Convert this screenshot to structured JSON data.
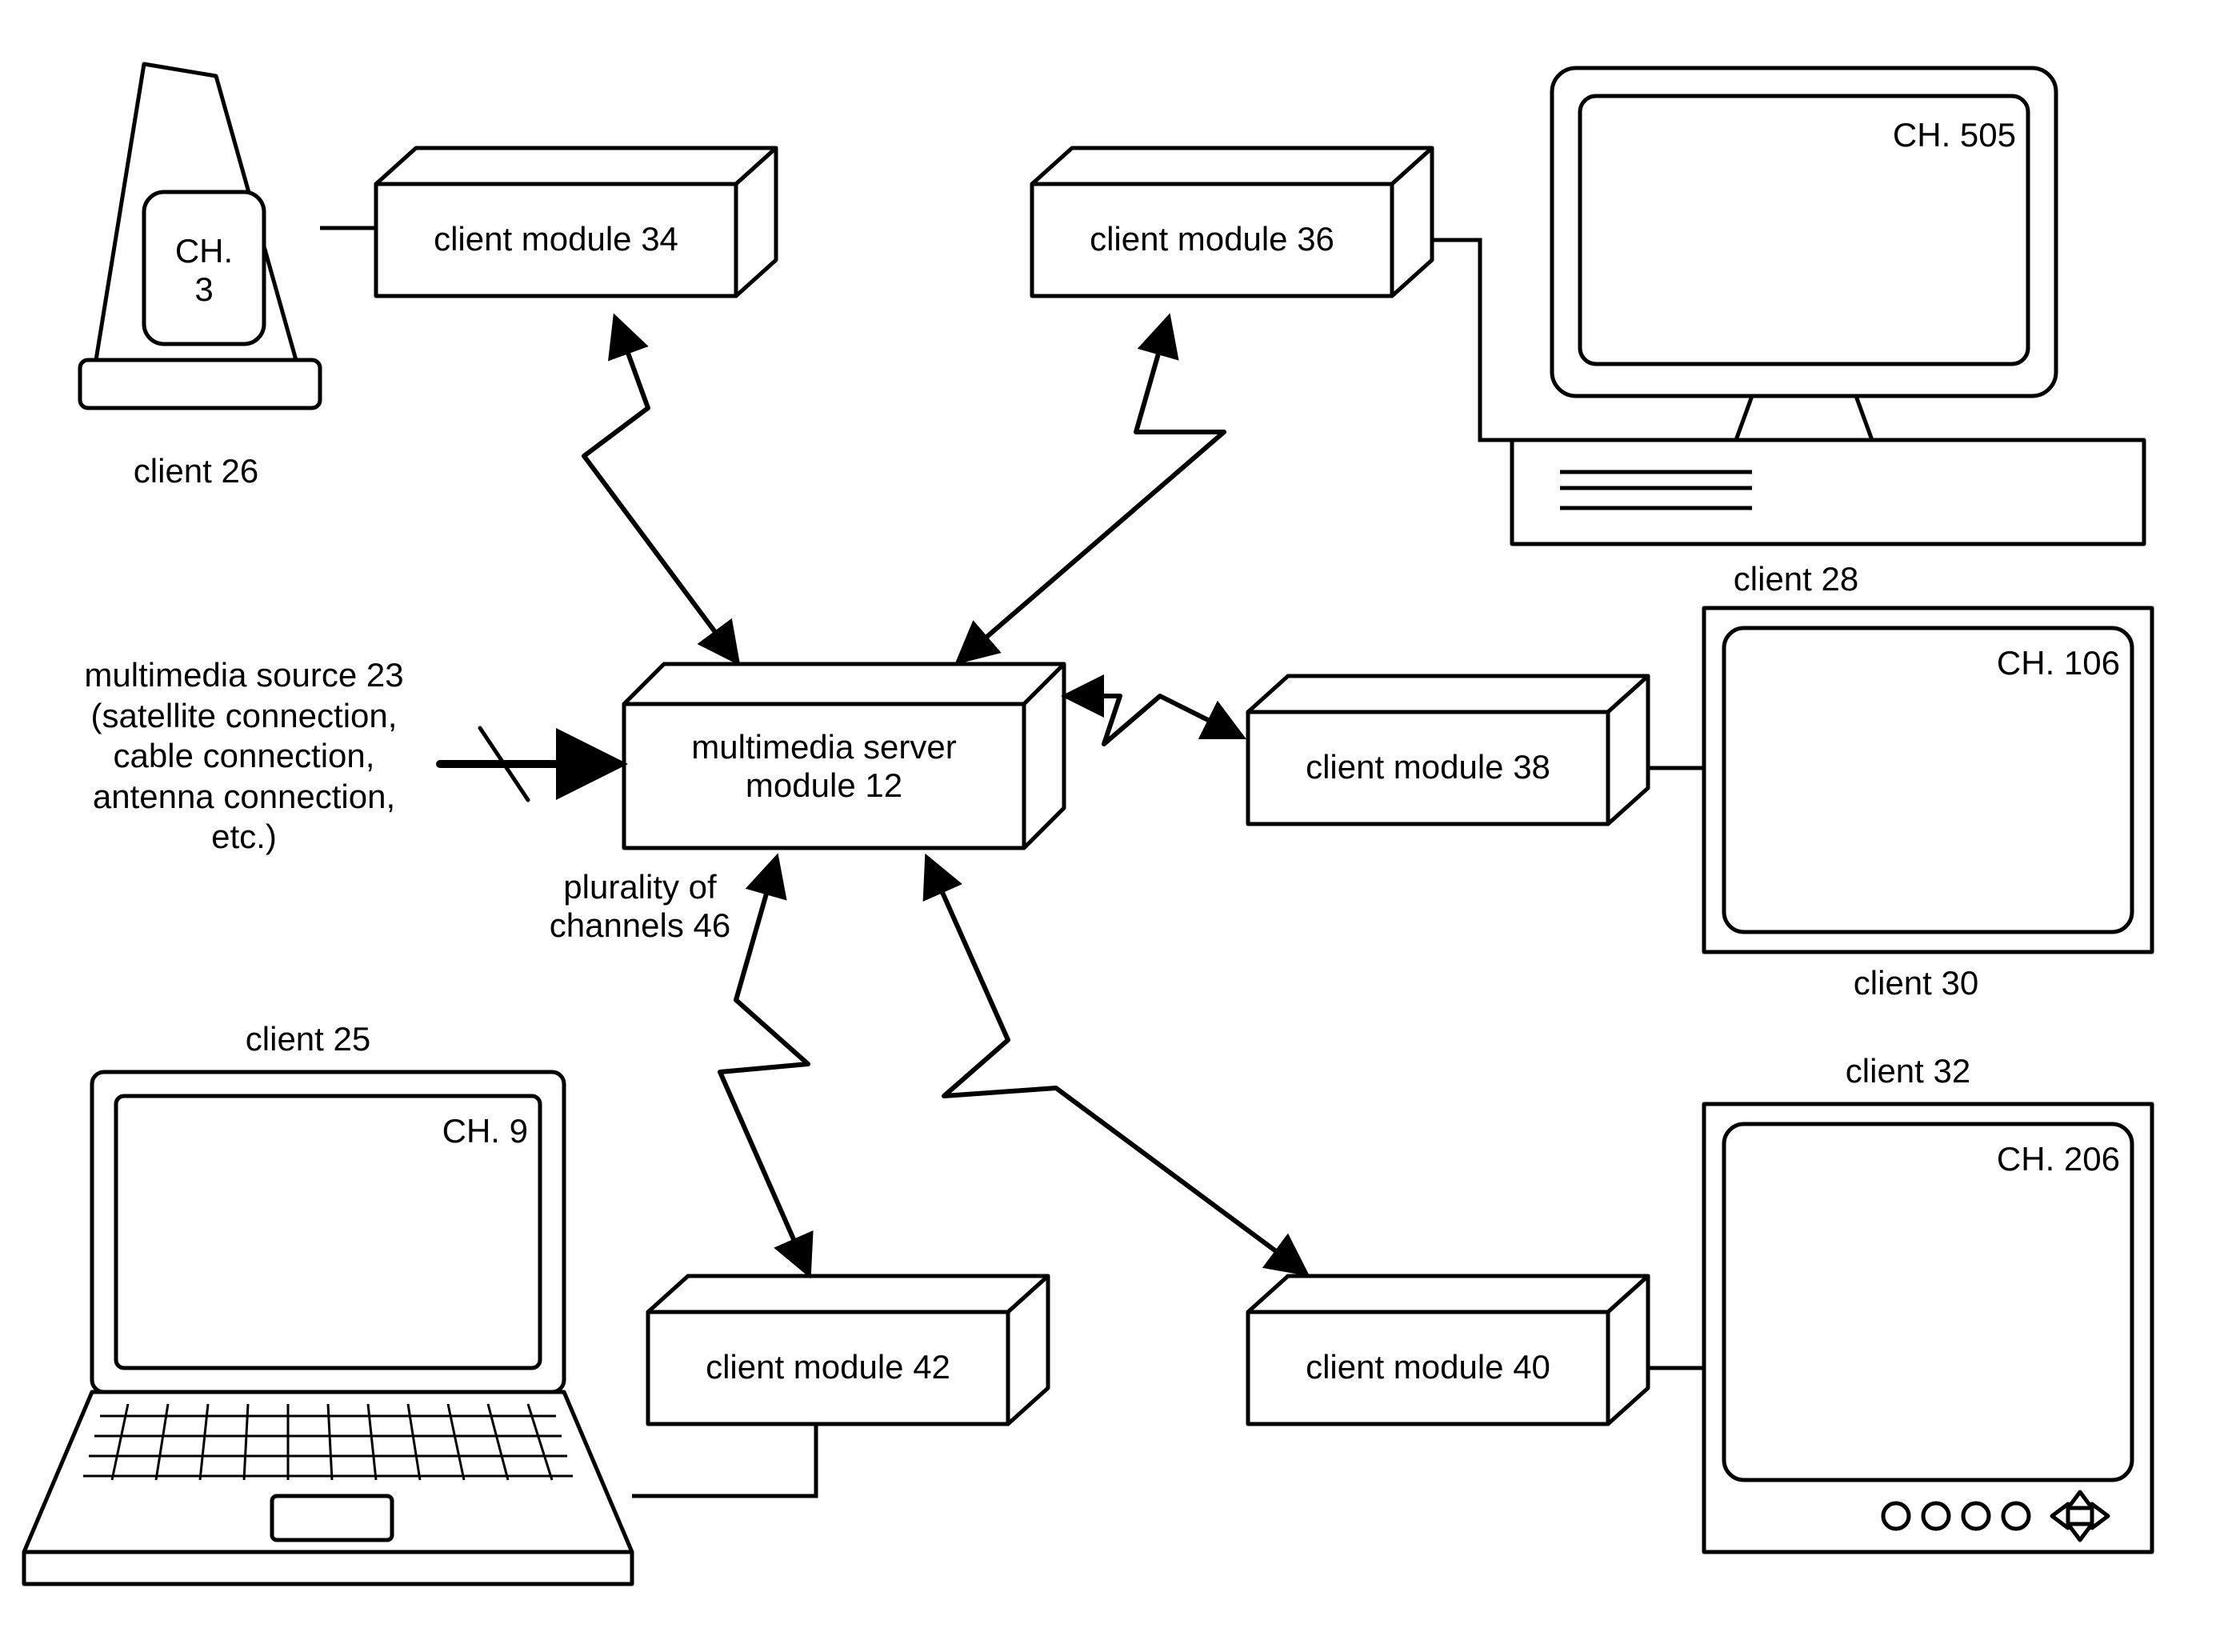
{
  "source": {
    "title": "multimedia source 23",
    "desc": "(satellite connection,\ncable connection,\nantenna connection,\netc.)"
  },
  "plurality": "plurality of\nchannels 46",
  "server": "multimedia server\nmodule 12",
  "cm34": "client module 34",
  "cm36": "client module 36",
  "cm38": "client module 38",
  "cm40": "client module 40",
  "cm42": "client module 42",
  "client26_label": "client 26",
  "client28_label": "client 28",
  "client30_label": "client 30",
  "client32_label": "client 32",
  "client25_label": "client 25",
  "ch3": "CH.\n3",
  "ch9": "CH. 9",
  "ch106": "CH. 106",
  "ch206": "CH. 206",
  "ch505": "CH. 505"
}
